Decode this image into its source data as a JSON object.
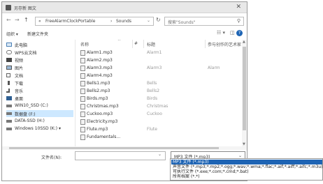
{
  "window": {
    "title": "另存新 图文"
  },
  "nav": {
    "back": "←",
    "forward": "→",
    "up": "↑",
    "breadcrumb": [
      "«",
      "FreeAlarmClockPortable",
      "›",
      "Sounds"
    ],
    "search_placeholder": "搜索\"Sounds\""
  },
  "toolbar": {
    "organize": "组织 ▾",
    "new_folder": "新建文件夹",
    "view": "☷ ▾",
    "pane": "◫",
    "help": "?"
  },
  "sidebar": {
    "items": [
      {
        "label": "此电脑",
        "icon": "computer-icon"
      },
      {
        "label": "WPS云文档",
        "icon": "cloud-icon"
      },
      {
        "label": "视频",
        "icon": "video-icon"
      },
      {
        "label": "图片",
        "icon": "picture-icon"
      },
      {
        "label": "文档",
        "icon": "document-icon"
      },
      {
        "label": "下载",
        "icon": "download-icon"
      },
      {
        "label": "音乐",
        "icon": "music-icon"
      },
      {
        "label": "桌面",
        "icon": "desktop-icon"
      },
      {
        "label": "WIN10_SSD (C:)",
        "icon": "drive-icon"
      },
      {
        "label": "数据盘 (F:)",
        "icon": "drive-icon",
        "selected": true
      },
      {
        "label": "DATA-SSD (H:)",
        "icon": "drive-icon"
      },
      {
        "label": "Windows 10SSD (K:) ▾",
        "icon": "drive-icon"
      }
    ]
  },
  "filelist": {
    "columns": {
      "name": "名称",
      "number": "#",
      "title": "标题",
      "artist": "参与创作的艺术家"
    },
    "rows": [
      {
        "name": "Alarm1.mp3",
        "title": "Alarm1",
        "artist": ""
      },
      {
        "name": "Alarm2.mp3",
        "title": "",
        "artist": ""
      },
      {
        "name": "Alarm3.mp3",
        "title": "Alarm3",
        "artist": "Alarm"
      },
      {
        "name": "Alarm4.mp3",
        "title": "",
        "artist": ""
      },
      {
        "name": "Bells1.mp3",
        "title": "Bells",
        "artist": ""
      },
      {
        "name": "Bells2.mp3",
        "title": "Bells2",
        "artist": ""
      },
      {
        "name": "Birds.mp3",
        "title": "Birds",
        "artist": ""
      },
      {
        "name": "Christmas.mp3",
        "title": "Christmas",
        "artist": ""
      },
      {
        "name": "Cuckoo.mp3",
        "title": "Cuckoo",
        "artist": ""
      },
      {
        "name": "Electricity.mp3",
        "title": "",
        "artist": ""
      },
      {
        "name": "Flute.mp3",
        "title": "Flute",
        "artist": ""
      },
      {
        "name": "Fundamentals...",
        "title": "",
        "artist": ""
      }
    ]
  },
  "footer": {
    "filename_label": "文件名(N):",
    "filename_value": "",
    "filter_selected": "MP3 文件 (*.mp3)"
  },
  "dropdown": {
    "options": [
      {
        "label": "MP3 文件 (*.mp3)",
        "highlight": true
      },
      {
        "label": "声音文件 (*.mp3;*.mp2;*.ogg;*.wav;*.wma;*.flac;*.aif;*.aiff;*.aifc;*.m3u)",
        "highlight": false
      },
      {
        "label": "可执行文件 (*.exe;*.com;*.cmd;*.bat)",
        "highlight": false
      },
      {
        "label": "所有档案 (*.*)",
        "highlight": false
      }
    ]
  }
}
